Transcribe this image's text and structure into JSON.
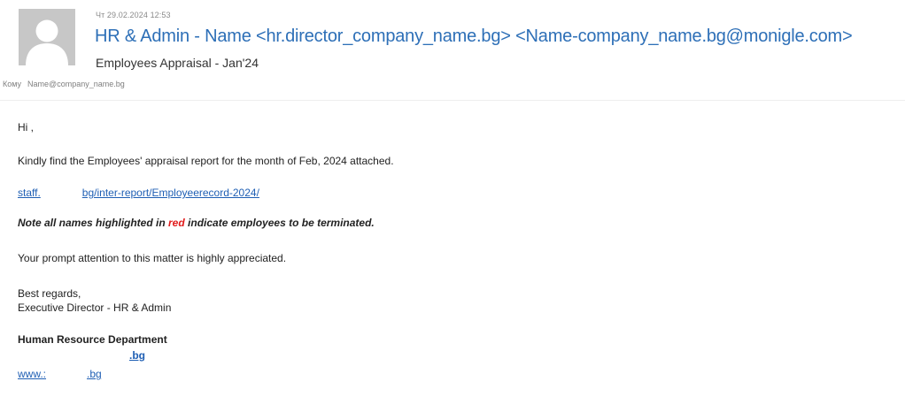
{
  "header": {
    "timestamp": "Чт 29.02.2024 12:53",
    "from": "HR & Admin - Name <hr.director_company_name.bg> <Name-company_name.bg@monigle.com>",
    "subject": "Employees Appraisal - Jan'24",
    "to_label": "Кому",
    "to_address": "Name@company_name.bg",
    "avatar_icon": "person-silhouette-icon"
  },
  "body": {
    "greeting": "Hi        ,",
    "intro": "Kindly find the Employees' appraisal report for the month of Feb, 2024 attached.",
    "link_part1": "staff.",
    "link_part2": "bg/inter-report/Employeerecord-2024/",
    "note_before": "Note all names highlighted in ",
    "note_red": "red",
    "note_after": " indicate employees to be terminated.",
    "prompt": "Your prompt attention to this matter is highly appreciated.",
    "regards": "Best regards,",
    "title": "Executive Director - HR & Admin",
    "department": "Human Resource Department",
    "sig_link1": ".bg",
    "sig_link2_part1": "www.:",
    "sig_link2_part2": ".bg"
  },
  "colors": {
    "from_blue": "#2d6fb7",
    "link_blue": "#1f5fb4",
    "highlight_red": "#e11b1b",
    "avatar_gray": "#c7c7c7"
  }
}
